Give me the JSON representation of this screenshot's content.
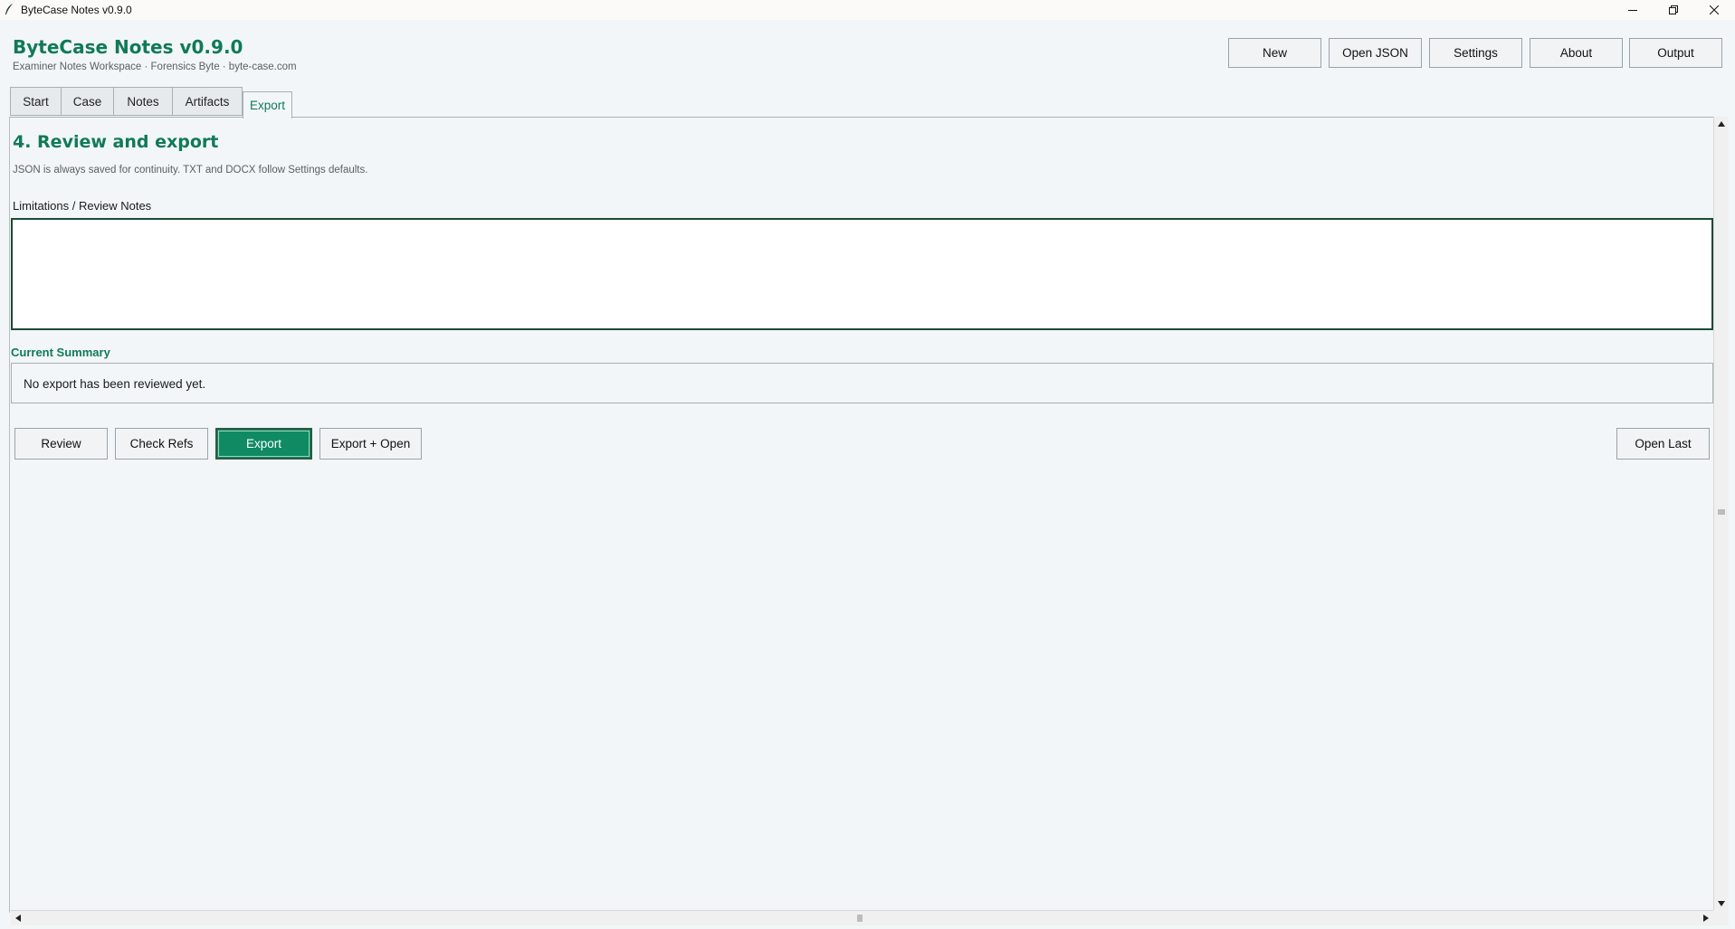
{
  "window": {
    "title": "ByteCase Notes v0.9.0",
    "icon": "quill-icon"
  },
  "header": {
    "app_title": "ByteCase Notes v0.9.0",
    "subtitle": "Examiner Notes Workspace · Forensics Byte · byte-case.com",
    "accent_color": "#107a55"
  },
  "toolbar": {
    "new_label": "New",
    "open_json_label": "Open JSON",
    "settings_label": "Settings",
    "about_label": "About",
    "output_label": "Output"
  },
  "tabs": [
    {
      "label": "Start"
    },
    {
      "label": "Case"
    },
    {
      "label": "Notes"
    },
    {
      "label": "Artifacts"
    },
    {
      "label": "Export",
      "active": true
    }
  ],
  "export_section": {
    "title": "4. Review and export",
    "description": "JSON is always saved for continuity. TXT and DOCX follow Settings defaults.",
    "notes_label": "Limitations / Review Notes",
    "notes_value": "",
    "summary_label": "Current Summary",
    "summary_text": "No export has been reviewed yet."
  },
  "actions": {
    "review_label": "Review",
    "check_refs_label": "Check Refs",
    "export_label": "Export",
    "export_open_label": "Export + Open",
    "open_last_label": "Open Last",
    "primary_color": "#0f8a62"
  }
}
